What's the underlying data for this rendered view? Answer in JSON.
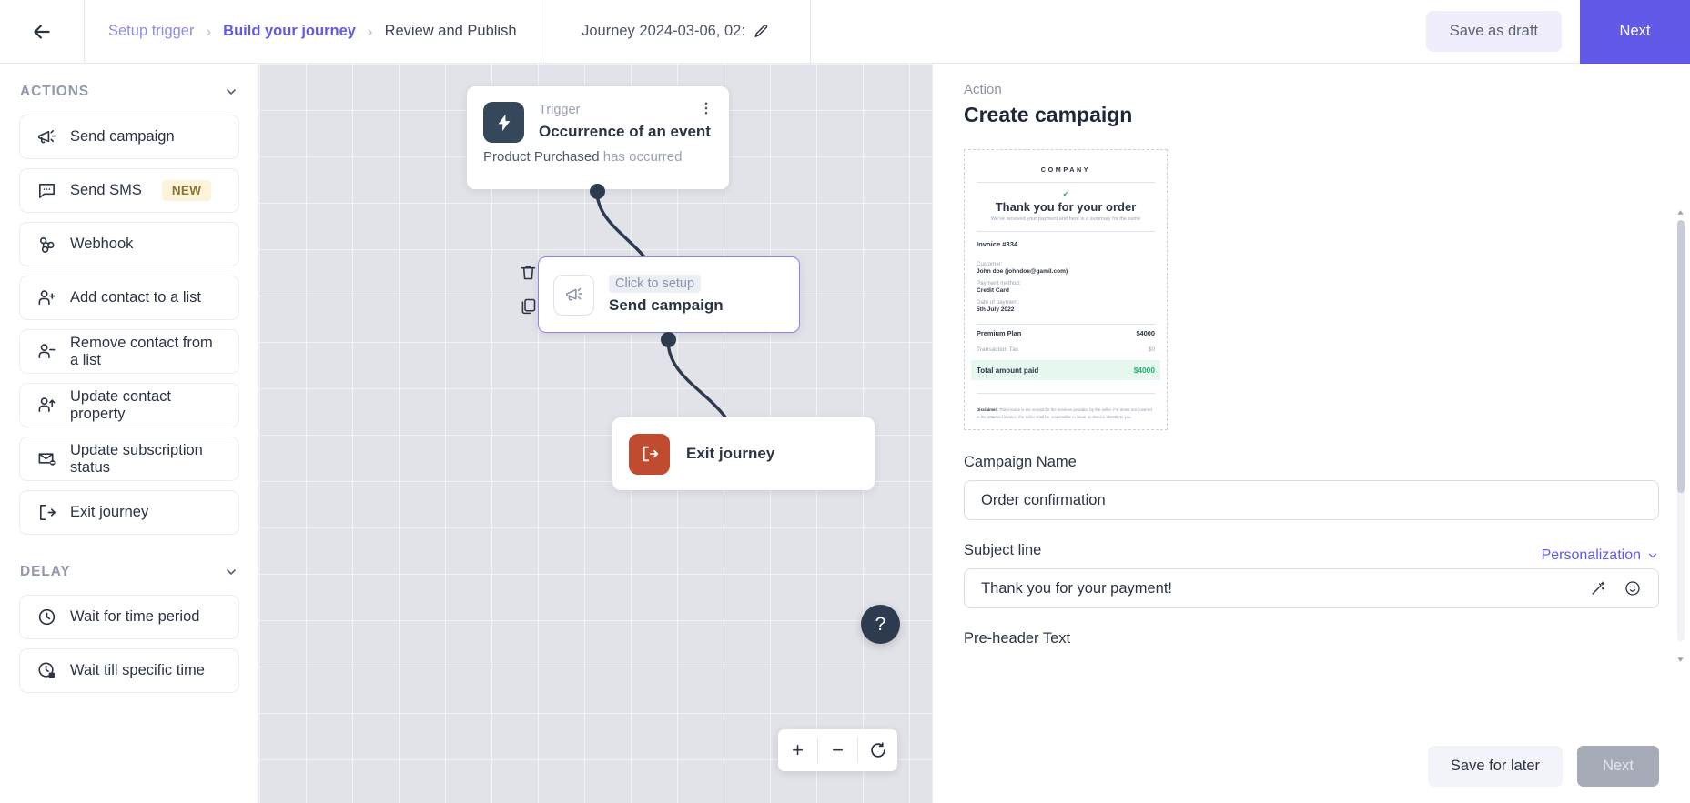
{
  "topbar": {
    "back_icon": "arrow-left-icon",
    "breadcrumb": [
      {
        "label": "Setup trigger",
        "state": "muted"
      },
      {
        "label": "Build your journey",
        "state": "active"
      },
      {
        "label": "Review and Publish",
        "state": "plain"
      }
    ],
    "separator": "›",
    "journey_title": "Journey 2024-03-06, 02:",
    "edit_icon": "pencil-icon",
    "save_draft_label": "Save as draft",
    "next_label": "Next",
    "accent_color": "#6359e9"
  },
  "sidebar": {
    "sections": [
      {
        "title": "ACTIONS",
        "items": [
          {
            "label": "Send campaign",
            "icon": "megaphone-icon",
            "badge": ""
          },
          {
            "label": "Send SMS",
            "icon": "chat-bubble-icon",
            "badge": "NEW"
          },
          {
            "label": "Webhook",
            "icon": "webhook-icon",
            "badge": ""
          },
          {
            "label": "Add contact to a list",
            "icon": "user-plus-icon",
            "badge": ""
          },
          {
            "label": "Remove contact from a list",
            "icon": "user-minus-icon",
            "badge": ""
          },
          {
            "label": "Update contact property",
            "icon": "user-up-icon",
            "badge": ""
          },
          {
            "label": "Update subscription status",
            "icon": "envelope-minus-icon",
            "badge": ""
          },
          {
            "label": "Exit journey",
            "icon": "exit-icon",
            "badge": ""
          }
        ]
      },
      {
        "title": "DELAY",
        "items": [
          {
            "label": "Wait for time period",
            "icon": "clock-icon",
            "badge": ""
          },
          {
            "label": "Wait till specific time",
            "icon": "clock-calendar-icon",
            "badge": ""
          }
        ]
      }
    ]
  },
  "canvas": {
    "trigger_node": {
      "kicker": "Trigger",
      "title": "Occurrence of an event",
      "subject": "Product Purchased",
      "suffix": "has occurred",
      "icon": "lightning-bolt-icon",
      "menu_icon": "kebab-menu-icon"
    },
    "campaign_node": {
      "chip": "Click to setup",
      "title": "Send campaign",
      "icon": "megaphone-icon",
      "delete_icon": "trash-icon",
      "duplicate_icon": "copy-icon"
    },
    "exit_node": {
      "title": "Exit journey",
      "icon": "exit-icon"
    },
    "help_label": "?",
    "zoom_in": "+",
    "zoom_out": "−",
    "zoom_reset": "reset-icon"
  },
  "rightpanel": {
    "kicker": "Action",
    "title": "Create campaign",
    "email_preview": {
      "company": "COMPANY",
      "heading": "Thank you for your order",
      "subheading": "We've received your payment and here is a summary for the same",
      "invoice_no": "Invoice #334",
      "customer_label": "Customer:",
      "customer_value": "John doe (johndoe@gamil.com)",
      "payment_label": "Payment method:",
      "payment_value": "Credit Card",
      "date_label": "Date of payment:",
      "date_value": "5th July 2022",
      "line_items": [
        {
          "name": "Premium Plan",
          "amount": "$4000",
          "bold": true
        },
        {
          "name": "Transaction Tax",
          "amount": "$0",
          "bold": false
        }
      ],
      "total_label": "Total amount paid",
      "total_value": "$4000",
      "total_color": "#21b473",
      "disclaimer_bold": "Disclaimer:",
      "disclaimer": "This invoice is the receipt for the services provided by the seller. For items not covered in the attached invoice, the seller shall be responsible to issue an invoice directly to you."
    },
    "campaign_name_label": "Campaign Name",
    "campaign_name_value": "Order confirmation",
    "subject_label": "Subject line",
    "personalization_label": "Personalization",
    "subject_value": "Thank you for your payment!",
    "subject_icons": [
      "magic-wand-icon",
      "emoji-icon"
    ],
    "preheader_label": "Pre-header Text",
    "save_later_label": "Save for later",
    "next_label": "Next"
  }
}
